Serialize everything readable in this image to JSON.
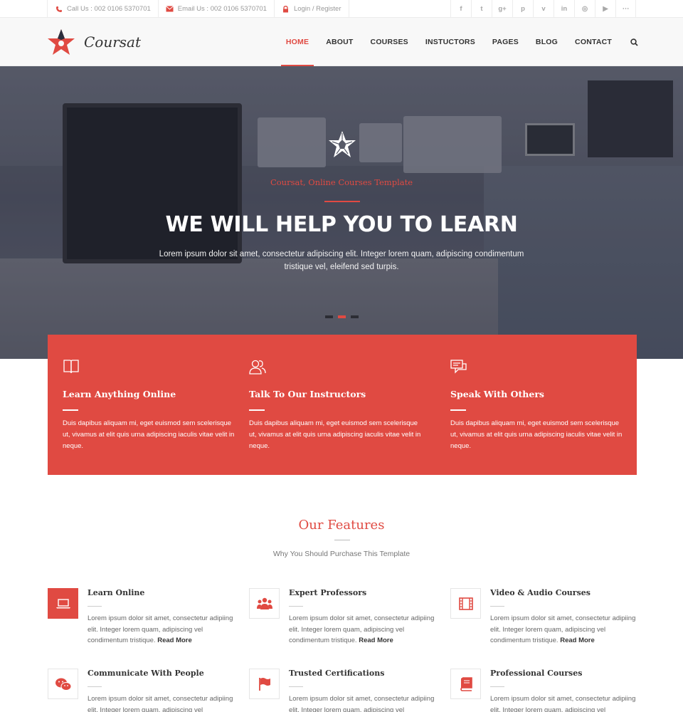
{
  "topbar": {
    "call": "Call Us : 002 0106 5370701",
    "email": "Email Us : 002 0106 5370701",
    "login": "Login / Register",
    "social_icons": [
      "facebook-icon",
      "twitter-icon",
      "google-plus-icon",
      "pinterest-icon",
      "vimeo-icon",
      "linkedin-icon",
      "dribbble-icon",
      "youtube-icon",
      "rss-icon"
    ],
    "social_glyphs": [
      "f",
      "t",
      "g+",
      "p",
      "v",
      "in",
      "◎",
      "▶",
      "⋯"
    ]
  },
  "header": {
    "logo_text": "Coursat",
    "nav": [
      "HOME",
      "ABOUT",
      "COURSES",
      "INSTUCTORS",
      "PAGES",
      "BLOG",
      "CONTACT"
    ],
    "active_nav": "HOME"
  },
  "hero": {
    "subtitle": "Coursat, Online Courses Template",
    "title": "WE WILL HELP YOU TO LEARN",
    "text": "Lorem ipsum dolor sit amet, consectetur adipiscing elit. Integer lorem quam, adipiscing condimentum tristique vel, eleifend sed turpis.",
    "slide_count": 3,
    "active_slide": 2
  },
  "highlights": [
    {
      "icon": "book-icon",
      "title": "Learn Anything Online",
      "text": "Duis dapibus aliquam mi, eget euismod sem scelerisque ut, vivamus at elit quis urna adipiscing iaculis vitae velit in neque."
    },
    {
      "icon": "users-icon",
      "title": "Talk To Our Instructors",
      "text": "Duis dapibus aliquam mi, eget euismod sem scelerisque ut, vivamus at elit quis urna adipiscing iaculis vitae velit in neque."
    },
    {
      "icon": "chat-icon",
      "title": "Speak With Others",
      "text": "Duis dapibus aliquam mi, eget euismod sem scelerisque ut, vivamus at elit quis urna adipiscing iaculis vitae velit in neque."
    }
  ],
  "features": {
    "title": "Our Features",
    "subtitle": "Why You Should Purchase This Template",
    "read_more": "Read More",
    "items": [
      {
        "icon": "laptop-icon",
        "title": "Learn Online",
        "text": "Lorem ipsum dolor sit amet, consectetur adipiing elit. Integer lorem quam, adipiscing vel condimentum tristique."
      },
      {
        "icon": "group-icon",
        "title": "Expert Professors",
        "text": "Lorem ipsum dolor sit amet, consectetur adipiing elit. Integer lorem quam, adipiscing vel condimentum tristique."
      },
      {
        "icon": "film-icon",
        "title": "Video & Audio Courses",
        "text": "Lorem ipsum dolor sit amet, consectetur adipiing elit. Integer lorem quam, adipiscing vel condimentum tristique."
      },
      {
        "icon": "wechat-icon",
        "title": "Communicate With People",
        "text": "Lorem ipsum dolor sit amet, consectetur adipiing elit. Integer lorem quam, adipiscing vel condimentum tristique."
      },
      {
        "icon": "flag-icon",
        "title": "Trusted Certifications",
        "text": "Lorem ipsum dolor sit amet, consectetur adipiing elit. Integer lorem quam, adipiscing vel condimentum tristique."
      },
      {
        "icon": "book-closed-icon",
        "title": "Professional Courses",
        "text": "Lorem ipsum dolor sit amet, consectetur adipiing elit. Integer lorem quam, adipiscing vel condimentum tristique."
      }
    ]
  },
  "colors": {
    "accent": "#e04a42",
    "dark": "#333333",
    "muted": "#999999"
  }
}
